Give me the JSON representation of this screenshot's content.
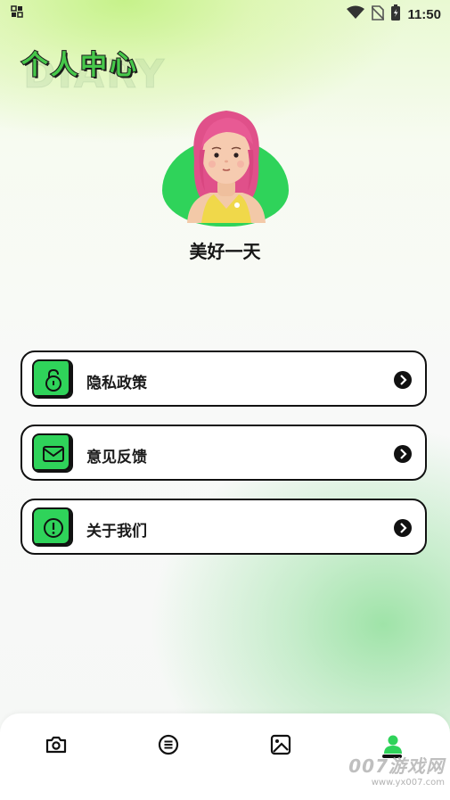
{
  "status_bar": {
    "time": "11:50",
    "icons": [
      "notification-icon",
      "wifi-icon",
      "no-sim-icon",
      "battery-icon"
    ]
  },
  "page": {
    "title": "个人中心",
    "title_shadow": "DIARY"
  },
  "profile": {
    "avatar": "cartoon-girl-avatar",
    "username": "美好一天"
  },
  "menu": [
    {
      "label": "隐私政策",
      "icon": "lock-icon"
    },
    {
      "label": "意见反馈",
      "icon": "mail-icon"
    },
    {
      "label": "关于我们",
      "icon": "info-icon"
    }
  ],
  "bottom_nav": {
    "items": [
      "camera-icon",
      "list-icon",
      "image-icon",
      "user-icon"
    ],
    "active_index": 3
  },
  "watermark": {
    "brand": "007游戏网",
    "url": "www.yx007.com"
  },
  "colors": {
    "accent": "#2fd35a",
    "text": "#151515",
    "border": "#111111"
  }
}
